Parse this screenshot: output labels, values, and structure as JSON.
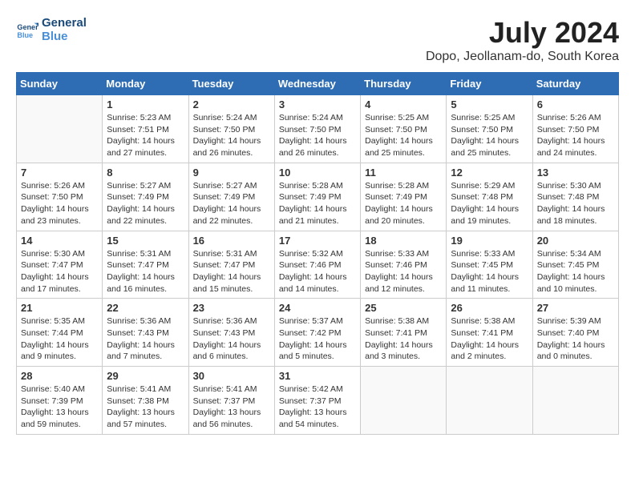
{
  "header": {
    "logo_line1": "General",
    "logo_line2": "Blue",
    "month_year": "July 2024",
    "location": "Dopo, Jeollanam-do, South Korea"
  },
  "weekdays": [
    "Sunday",
    "Monday",
    "Tuesday",
    "Wednesday",
    "Thursday",
    "Friday",
    "Saturday"
  ],
  "weeks": [
    [
      {
        "day": "",
        "text": ""
      },
      {
        "day": "1",
        "text": "Sunrise: 5:23 AM\nSunset: 7:51 PM\nDaylight: 14 hours\nand 27 minutes."
      },
      {
        "day": "2",
        "text": "Sunrise: 5:24 AM\nSunset: 7:50 PM\nDaylight: 14 hours\nand 26 minutes."
      },
      {
        "day": "3",
        "text": "Sunrise: 5:24 AM\nSunset: 7:50 PM\nDaylight: 14 hours\nand 26 minutes."
      },
      {
        "day": "4",
        "text": "Sunrise: 5:25 AM\nSunset: 7:50 PM\nDaylight: 14 hours\nand 25 minutes."
      },
      {
        "day": "5",
        "text": "Sunrise: 5:25 AM\nSunset: 7:50 PM\nDaylight: 14 hours\nand 25 minutes."
      },
      {
        "day": "6",
        "text": "Sunrise: 5:26 AM\nSunset: 7:50 PM\nDaylight: 14 hours\nand 24 minutes."
      }
    ],
    [
      {
        "day": "7",
        "text": "Sunrise: 5:26 AM\nSunset: 7:50 PM\nDaylight: 14 hours\nand 23 minutes."
      },
      {
        "day": "8",
        "text": "Sunrise: 5:27 AM\nSunset: 7:49 PM\nDaylight: 14 hours\nand 22 minutes."
      },
      {
        "day": "9",
        "text": "Sunrise: 5:27 AM\nSunset: 7:49 PM\nDaylight: 14 hours\nand 22 minutes."
      },
      {
        "day": "10",
        "text": "Sunrise: 5:28 AM\nSunset: 7:49 PM\nDaylight: 14 hours\nand 21 minutes."
      },
      {
        "day": "11",
        "text": "Sunrise: 5:28 AM\nSunset: 7:49 PM\nDaylight: 14 hours\nand 20 minutes."
      },
      {
        "day": "12",
        "text": "Sunrise: 5:29 AM\nSunset: 7:48 PM\nDaylight: 14 hours\nand 19 minutes."
      },
      {
        "day": "13",
        "text": "Sunrise: 5:30 AM\nSunset: 7:48 PM\nDaylight: 14 hours\nand 18 minutes."
      }
    ],
    [
      {
        "day": "14",
        "text": "Sunrise: 5:30 AM\nSunset: 7:47 PM\nDaylight: 14 hours\nand 17 minutes."
      },
      {
        "day": "15",
        "text": "Sunrise: 5:31 AM\nSunset: 7:47 PM\nDaylight: 14 hours\nand 16 minutes."
      },
      {
        "day": "16",
        "text": "Sunrise: 5:31 AM\nSunset: 7:47 PM\nDaylight: 14 hours\nand 15 minutes."
      },
      {
        "day": "17",
        "text": "Sunrise: 5:32 AM\nSunset: 7:46 PM\nDaylight: 14 hours\nand 14 minutes."
      },
      {
        "day": "18",
        "text": "Sunrise: 5:33 AM\nSunset: 7:46 PM\nDaylight: 14 hours\nand 12 minutes."
      },
      {
        "day": "19",
        "text": "Sunrise: 5:33 AM\nSunset: 7:45 PM\nDaylight: 14 hours\nand 11 minutes."
      },
      {
        "day": "20",
        "text": "Sunrise: 5:34 AM\nSunset: 7:45 PM\nDaylight: 14 hours\nand 10 minutes."
      }
    ],
    [
      {
        "day": "21",
        "text": "Sunrise: 5:35 AM\nSunset: 7:44 PM\nDaylight: 14 hours\nand 9 minutes."
      },
      {
        "day": "22",
        "text": "Sunrise: 5:36 AM\nSunset: 7:43 PM\nDaylight: 14 hours\nand 7 minutes."
      },
      {
        "day": "23",
        "text": "Sunrise: 5:36 AM\nSunset: 7:43 PM\nDaylight: 14 hours\nand 6 minutes."
      },
      {
        "day": "24",
        "text": "Sunrise: 5:37 AM\nSunset: 7:42 PM\nDaylight: 14 hours\nand 5 minutes."
      },
      {
        "day": "25",
        "text": "Sunrise: 5:38 AM\nSunset: 7:41 PM\nDaylight: 14 hours\nand 3 minutes."
      },
      {
        "day": "26",
        "text": "Sunrise: 5:38 AM\nSunset: 7:41 PM\nDaylight: 14 hours\nand 2 minutes."
      },
      {
        "day": "27",
        "text": "Sunrise: 5:39 AM\nSunset: 7:40 PM\nDaylight: 14 hours\nand 0 minutes."
      }
    ],
    [
      {
        "day": "28",
        "text": "Sunrise: 5:40 AM\nSunset: 7:39 PM\nDaylight: 13 hours\nand 59 minutes."
      },
      {
        "day": "29",
        "text": "Sunrise: 5:41 AM\nSunset: 7:38 PM\nDaylight: 13 hours\nand 57 minutes."
      },
      {
        "day": "30",
        "text": "Sunrise: 5:41 AM\nSunset: 7:37 PM\nDaylight: 13 hours\nand 56 minutes."
      },
      {
        "day": "31",
        "text": "Sunrise: 5:42 AM\nSunset: 7:37 PM\nDaylight: 13 hours\nand 54 minutes."
      },
      {
        "day": "",
        "text": ""
      },
      {
        "day": "",
        "text": ""
      },
      {
        "day": "",
        "text": ""
      }
    ]
  ]
}
